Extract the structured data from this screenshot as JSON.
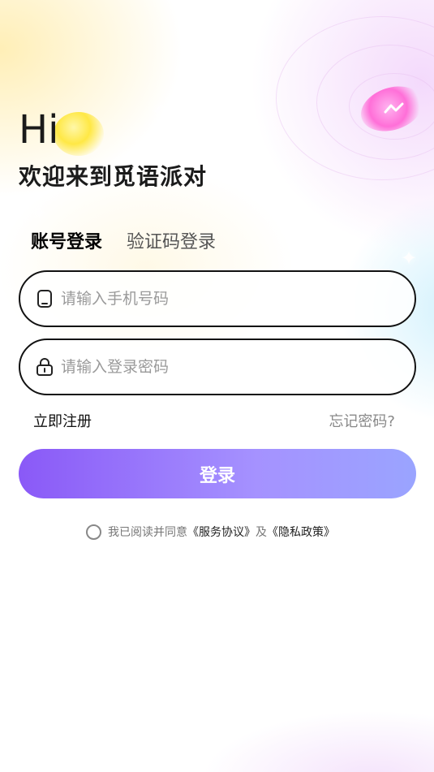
{
  "hero": {
    "greeting": "Hi",
    "welcome": "欢迎来到觅语派对"
  },
  "tabs": [
    {
      "label": "账号登录",
      "active": true
    },
    {
      "label": "验证码登录",
      "active": false
    }
  ],
  "form": {
    "phone_placeholder": "请输入手机号码",
    "password_placeholder": "请输入登录密码",
    "phone_icon": "phone-icon",
    "password_icon": "lock-icon"
  },
  "links": {
    "register": "立即注册",
    "forgot": "忘记密码?"
  },
  "login_button": "登录",
  "agreement": {
    "prefix": "我已阅读并同意",
    "service": "《服务协议》",
    "and": "及",
    "privacy": "《隐私政策》",
    "checked": false
  },
  "colors": {
    "accent_start": "#8a59f7",
    "accent_end": "#9aa4ff",
    "text_dark": "#1b1b1b"
  }
}
